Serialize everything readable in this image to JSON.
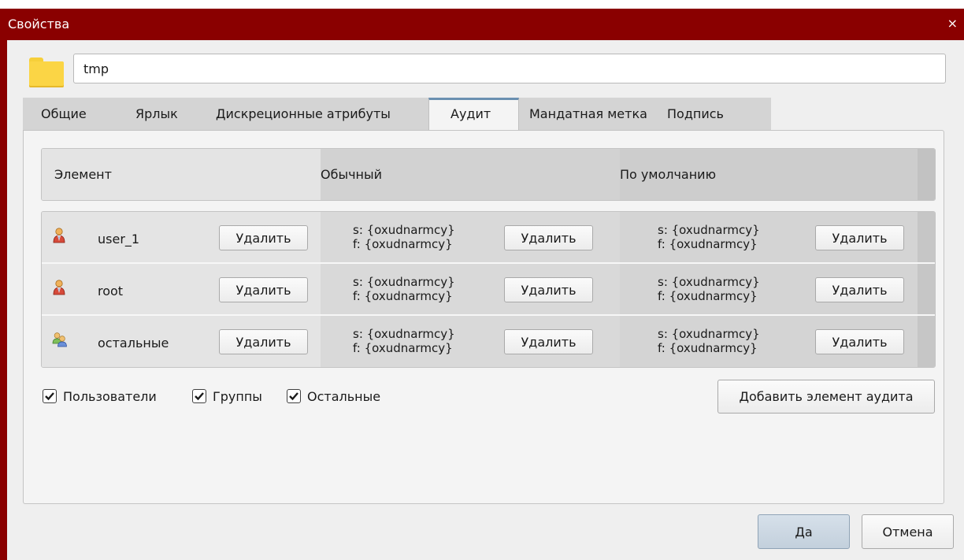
{
  "window": {
    "title": "Свойства",
    "close_glyph": "×"
  },
  "name_field": {
    "value": "tmp",
    "icon": "folder-icon"
  },
  "tabs": [
    {
      "label": "Общие",
      "active": false
    },
    {
      "label": "Ярлык",
      "active": false
    },
    {
      "label": "Дискреционные атрибуты",
      "active": false
    },
    {
      "label": "Аудит",
      "active": true
    },
    {
      "label": "Мандатная метка",
      "active": false
    },
    {
      "label": "Подпись",
      "active": false
    }
  ],
  "table": {
    "headers": {
      "element": "Элемент",
      "normal": "Обычный",
      "default": "По умолчанию"
    },
    "rows": [
      {
        "icon": "user-icon",
        "name": "user_1",
        "delete": "Удалить",
        "normal_s": "s: {oxudnarmcy}",
        "normal_f": "f: {oxudnarmcy}",
        "normal_delete": "Удалить",
        "default_s": "s: {oxudnarmcy}",
        "default_f": "f: {oxudnarmcy}",
        "default_delete": "Удалить"
      },
      {
        "icon": "user-icon",
        "name": "root",
        "delete": "Удалить",
        "normal_s": "s: {oxudnarmcy}",
        "normal_f": "f: {oxudnarmcy}",
        "normal_delete": "Удалить",
        "default_s": "s: {oxudnarmcy}",
        "default_f": "f: {oxudnarmcy}",
        "default_delete": "Удалить"
      },
      {
        "icon": "users-group-icon",
        "name": "остальные",
        "delete": "Удалить",
        "normal_s": "s: {oxudnarmcy}",
        "normal_f": "f: {oxudnarmcy}",
        "normal_delete": "Удалить",
        "default_s": "s: {oxudnarmcy}",
        "default_f": "f: {oxudnarmcy}",
        "default_delete": "Удалить"
      }
    ]
  },
  "filters": [
    {
      "label": "Пользователи",
      "checked": true
    },
    {
      "label": "Группы",
      "checked": true
    },
    {
      "label": "Остальные",
      "checked": true
    }
  ],
  "add_audit_button": "Добавить элемент аудита",
  "footer": {
    "ok": "Да",
    "cancel": "Отмена"
  },
  "colors": {
    "titlebar": "#8a0000",
    "folder": "#fbd545",
    "active_tab_accent": "#6a8fb0"
  }
}
